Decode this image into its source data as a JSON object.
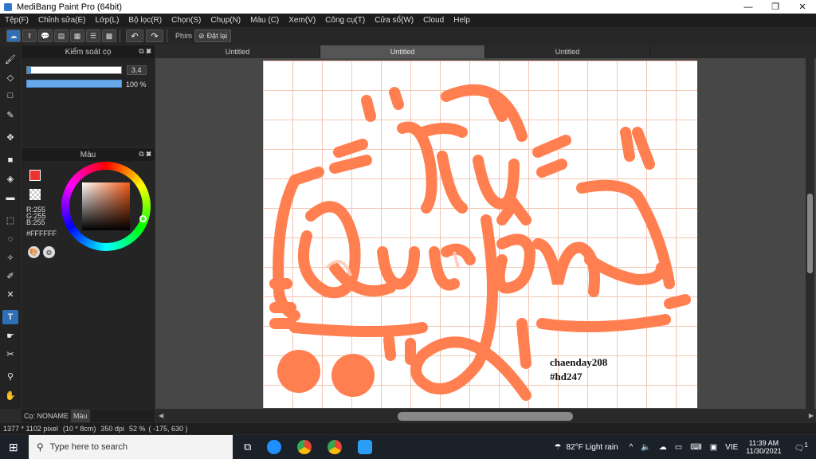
{
  "window": {
    "title": "MediBang Paint Pro (64bit)",
    "minimize_label": "—",
    "maximize_label": "❐",
    "close_label": "✕"
  },
  "menu": [
    "Tệp(F)",
    "Chỉnh sửa(E)",
    "Lớp(L)",
    "Bộ lọc(R)",
    "Chọn(S)",
    "Chụp(N)",
    "Màu (C)",
    "Xem(V)",
    "Công cụ(T)",
    "Cửa sổ(W)",
    "Cloud",
    "Help"
  ],
  "toolbar": {
    "keys_label": "Phím",
    "reset_label": "Đặt lại"
  },
  "brush_panel": {
    "title": "Kiểm soát cọ",
    "size_value": "3.4",
    "opacity_value": "100 %",
    "opacity_fraction": 1.0
  },
  "color_panel": {
    "title": "Màu",
    "r_label": "R:255",
    "g_label": "G:255",
    "b_label": "B:255",
    "hex_label": "#FFFFFF"
  },
  "tabs": [
    "Untitled",
    "Untitled",
    "Untitled"
  ],
  "active_tab_index": 1,
  "canvas_text": {
    "credit_line1": "chaenday208",
    "credit_line2": "#hd247",
    "lettering_line1": "Tú",
    "lettering_line2": "Quyên"
  },
  "accent_color": "#ff7f50",
  "panel_tabs": [
    "Cọ: NONAME",
    "Màu"
  ],
  "status_bar": {
    "size": "1377 * 1102 pixel",
    "physical": "(10 * 8cm)",
    "dpi": "350 dpi",
    "zoom": "52 %",
    "coords": "( -175, 630 )"
  },
  "taskbar": {
    "search_placeholder": "Type here to search",
    "weather": "82°F  Light rain",
    "lang": "VIE",
    "time": "11:39 AM",
    "date": "11/30/2021",
    "notif_count": "1"
  }
}
